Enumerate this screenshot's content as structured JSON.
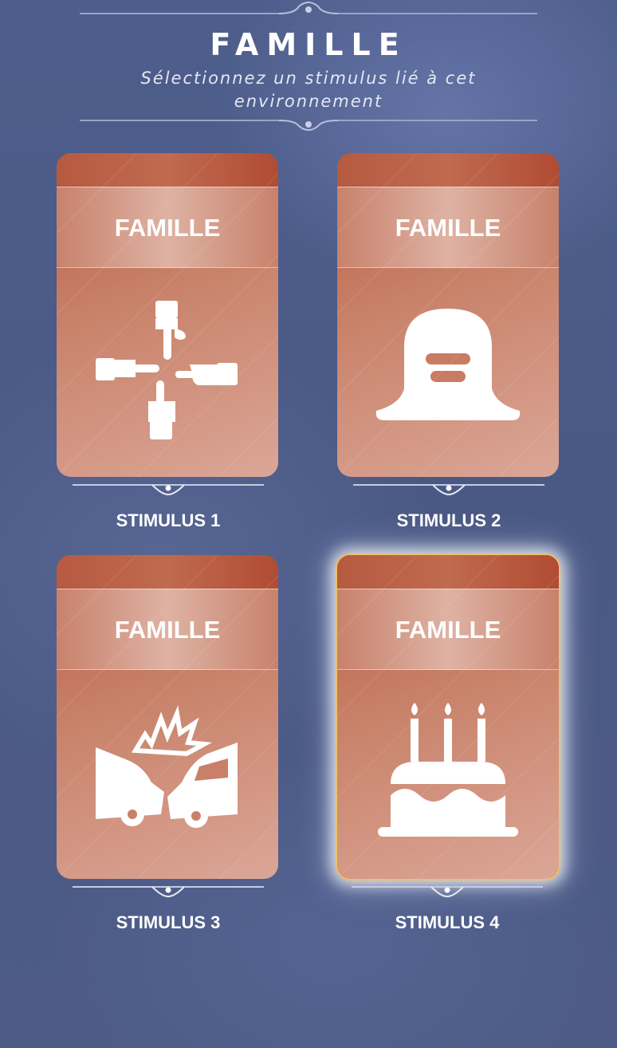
{
  "header": {
    "title": "FAMILLE",
    "subtitle": "Sélectionnez un stimulus lié à cet environnement"
  },
  "cards": [
    {
      "banner": "FAMILLE",
      "label": "STIMULUS 1",
      "icon": "pointing-hands-icon",
      "selected": false
    },
    {
      "banner": "FAMILLE",
      "label": "STIMULUS 2",
      "icon": "tombstone-icon",
      "selected": false
    },
    {
      "banner": "FAMILLE",
      "label": "STIMULUS 3",
      "icon": "car-crash-icon",
      "selected": false
    },
    {
      "banner": "FAMILLE",
      "label": "STIMULUS 4",
      "icon": "birthday-cake-icon",
      "selected": true
    }
  ],
  "colors": {
    "background": "#4e5e8c",
    "card_top": "#b85e44",
    "card_bottom": "#dba697",
    "selected_border": "#e8c46a",
    "text": "#ffffff"
  }
}
